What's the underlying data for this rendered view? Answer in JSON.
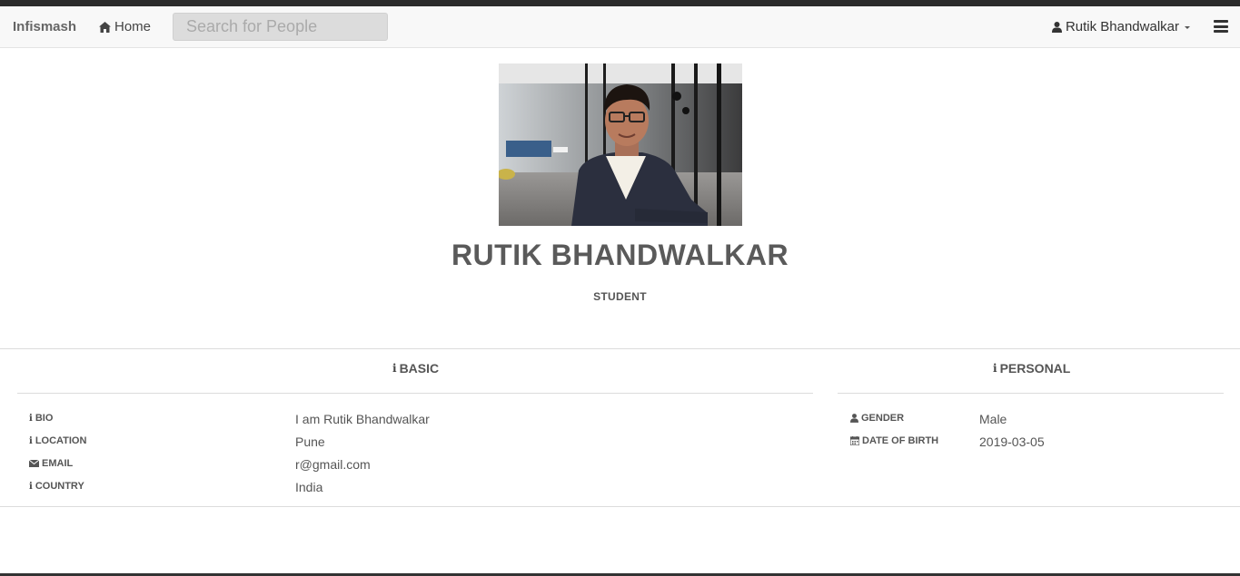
{
  "navbar": {
    "brand": "Infismash",
    "home_label": "Home",
    "search_placeholder": "Search for People",
    "user_name": "Rutik Bhandwalkar"
  },
  "profile": {
    "name": "RUTIK BHANDWALKAR",
    "role": "STUDENT"
  },
  "basic": {
    "title": "BASIC",
    "rows": [
      {
        "label": "BIO",
        "icon": "info-icon",
        "value": "I am Rutik Bhandwalkar"
      },
      {
        "label": "LOCATION",
        "icon": "info-icon",
        "value": "Pune"
      },
      {
        "label": "EMAIL",
        "icon": "envelope-icon",
        "value": "r@gmail.com"
      },
      {
        "label": "COUNTRY",
        "icon": "info-icon",
        "value": "India"
      }
    ]
  },
  "personal": {
    "title": "PERSONAL",
    "rows": [
      {
        "label": "GENDER",
        "icon": "user-icon",
        "value": "Male"
      },
      {
        "label": "DATE OF BIRTH",
        "icon": "calendar-icon",
        "value": "2019-03-05"
      }
    ]
  }
}
